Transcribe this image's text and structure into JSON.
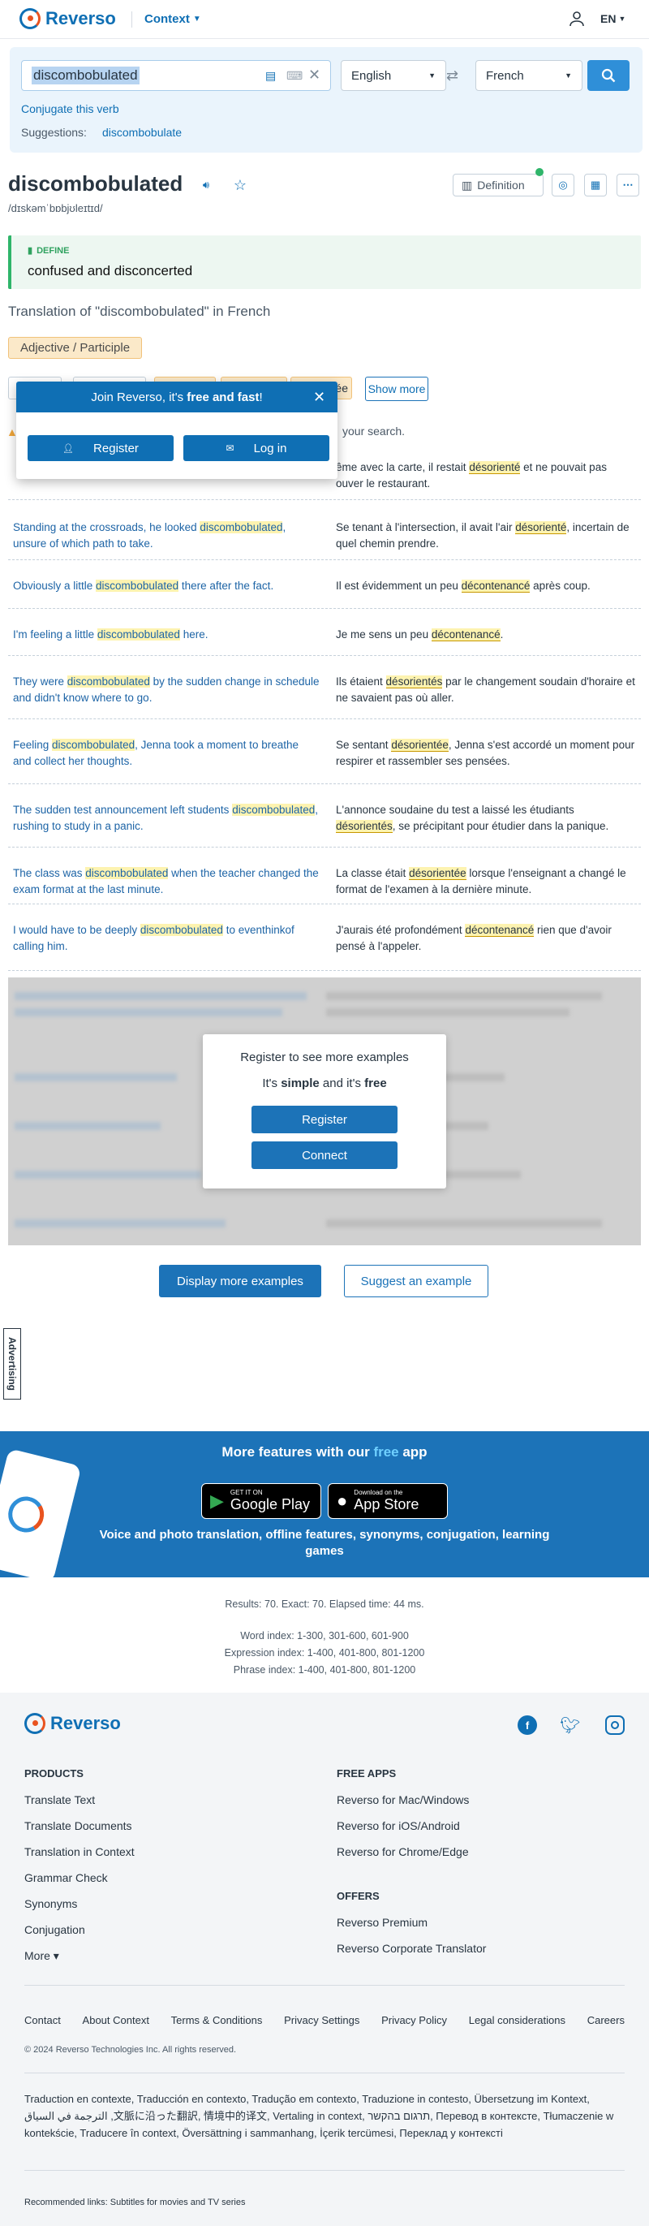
{
  "header": {
    "logo": "Reverso",
    "context_label": "Context",
    "lang": "EN"
  },
  "search": {
    "query": "discombobulated",
    "source_lang": "English",
    "target_lang": "French",
    "conjugate": "Conjugate this verb",
    "suggestions_label": "Suggestions:",
    "suggestion": "discombobulate"
  },
  "word": {
    "title": "discombobulated",
    "ipa": "/dɪskəmˈbɒbjʊleɪtɪd/",
    "definition_btn": "Definition"
  },
  "define": {
    "label": "DEFINE",
    "text": "confused and disconcerted"
  },
  "translation": {
    "heading": "Translation of \"discombobulated\" in French",
    "pos": "Adjective / Participle",
    "chips": [
      "désorienté",
      "décontenancé",
      "désorientés",
      "désorientée",
      "troublé"
    ],
    "show_more": "Show more",
    "notice": "your search."
  },
  "popup": {
    "title_pre": "Join Reverso, it's ",
    "title_bold": "free and fast",
    "title_post": "!",
    "register": "Register",
    "login": "Log in"
  },
  "examples": [
    {
      "src": [
        "Standing at the crossroads, he looked ",
        "discombobulated",
        ", unsure of which path to take."
      ],
      "trg": [
        "Se tenant à l'intersection, il avait l'air ",
        "désorienté",
        ", incertain de quel chemin prendre."
      ]
    },
    {
      "src": [
        "Obviously a little ",
        "discombobulated",
        " there after the fact."
      ],
      "trg": [
        "Il est évidemment un peu ",
        "décontenancé",
        " après coup."
      ]
    },
    {
      "src": [
        "I'm feeling a little ",
        "discombobulated",
        " here."
      ],
      "trg": [
        "Je me sens un peu ",
        "décontenancé",
        "."
      ]
    },
    {
      "src": [
        "They were ",
        "discombobulated",
        " by the sudden change in schedule and didn't know where to go."
      ],
      "trg": [
        "Ils étaient ",
        "désorientés",
        " par le changement soudain d'horaire et ne savaient pas où aller."
      ]
    },
    {
      "src": [
        "Feeling ",
        "discombobulated",
        ", Jenna took a moment to breathe and collect her thoughts."
      ],
      "trg": [
        "Se sentant ",
        "désorientée",
        ", Jenna s'est accordé un moment pour respirer et rassembler ses pensées."
      ]
    },
    {
      "src": [
        "The sudden test announcement left students ",
        "discombobulated",
        ", rushing to study in a panic."
      ],
      "trg": [
        "L'annonce soudaine du test a laissé les étudiants ",
        "désorientés",
        ", se précipitant pour étudier dans la panique."
      ]
    },
    {
      "src": [
        "The class was ",
        "discombobulated",
        " when the teacher changed the exam format at the last minute."
      ],
      "trg": [
        "La classe était ",
        "désorientée",
        " lorsque l'enseignant a changé le format de l'examen à la dernière minute."
      ]
    },
    {
      "src": [
        "I would have to be deeply ",
        "discombobulated",
        " to eventhinkof calling him."
      ],
      "trg": [
        "J'aurais été profondément ",
        "décontenancé",
        " rien que d'avoir pensé à l'appeler."
      ]
    }
  ],
  "first_example_partial": {
    "trg_a": "ême avec la carte, il restait ",
    "trg_hl": "désorienté",
    "trg_b": " et ne pouvait pas",
    "trg_c": "ouver le restaurant."
  },
  "register_modal": {
    "title": "Register to see more examples",
    "sub_pre": "It's ",
    "sub_b1": "simple",
    "sub_mid": " and it's ",
    "sub_b2": "free",
    "register": "Register",
    "connect": "Connect"
  },
  "actions": {
    "more": "Display more examples",
    "suggest": "Suggest an example"
  },
  "ad_label": "Advertising",
  "app": {
    "title_pre": "More features with our ",
    "title_free": "free",
    "title_post": " app",
    "google_small": "GET IT ON",
    "google": "Google Play",
    "apple_small": "Download on the",
    "apple": "App Store",
    "features": "Voice and photo translation, offline features, synonyms, conjugation, learning games"
  },
  "stats": {
    "results": "Results: 70. Exact: 70. Elapsed time: 44 ms.",
    "word_index": "Word index: 1-300, 301-600, 601-900",
    "expression_index": "Expression index: 1-400, 401-800, 801-1200",
    "phrase_index": "Phrase index: 1-400, 401-800, 801-1200"
  },
  "footer": {
    "products_title": "PRODUCTS",
    "products": [
      "Translate Text",
      "Translate Documents",
      "Translation in Context",
      "Grammar Check",
      "Synonyms",
      "Conjugation",
      "More"
    ],
    "apps_title": "FREE APPS",
    "apps": [
      "Reverso for Mac/Windows",
      "Reverso for iOS/Android",
      "Reverso for Chrome/Edge"
    ],
    "offers_title": "OFFERS",
    "offers": [
      "Reverso Premium",
      "Reverso Corporate Translator"
    ],
    "links": [
      "Contact",
      "About Context",
      "Terms & Conditions",
      "Privacy Settings",
      "Privacy Policy",
      "Legal considerations",
      "Careers"
    ],
    "copyright": "© 2024 Reverso Technologies Inc. All rights reserved.",
    "langs": "Traduction en contexte, Traducción en contexto, Tradução em contexto, Traduzione in contesto, Übersetzung im Kontext, الترجمة في السياق ,文脈に沿った翻訳, 情境中的译文, Vertaling in context, תרגום בהקשר, Перевод в контексте, Tłumaczenie w kontekście, Traducere în context, Översättning i sammanhang, İçerik tercümesi, Переклад у контексті",
    "recommended": "Recommended links: Subtitles for movies and TV series"
  },
  "colors": {
    "brand": "#0f6fb4",
    "accent": "#e9531f",
    "highlight": "#fdf3b0",
    "app_band": "#1c73b8"
  }
}
